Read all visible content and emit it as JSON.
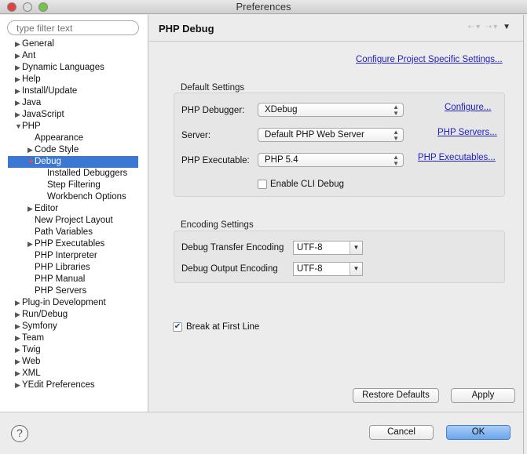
{
  "window": {
    "title": "Preferences"
  },
  "sidebar": {
    "filter_placeholder": "type filter text",
    "items": [
      {
        "label": "General",
        "level": 0,
        "exp": "c"
      },
      {
        "label": "Ant",
        "level": 0,
        "exp": "c"
      },
      {
        "label": "Dynamic Languages",
        "level": 0,
        "exp": "c"
      },
      {
        "label": "Help",
        "level": 0,
        "exp": "c"
      },
      {
        "label": "Install/Update",
        "level": 0,
        "exp": "c"
      },
      {
        "label": "Java",
        "level": 0,
        "exp": "c"
      },
      {
        "label": "JavaScript",
        "level": 0,
        "exp": "c"
      },
      {
        "label": "PHP",
        "level": 0,
        "exp": "e"
      },
      {
        "label": "Appearance",
        "level": 1,
        "exp": ""
      },
      {
        "label": "Code Style",
        "level": 1,
        "exp": "c"
      },
      {
        "label": "Debug",
        "level": 1,
        "exp": "e",
        "selected": true
      },
      {
        "label": "Installed Debuggers",
        "level": 2,
        "exp": ""
      },
      {
        "label": "Step Filtering",
        "level": 2,
        "exp": ""
      },
      {
        "label": "Workbench Options",
        "level": 2,
        "exp": ""
      },
      {
        "label": "Editor",
        "level": 1,
        "exp": "c"
      },
      {
        "label": "New Project Layout",
        "level": 1,
        "exp": ""
      },
      {
        "label": "Path Variables",
        "level": 1,
        "exp": ""
      },
      {
        "label": "PHP Executables",
        "level": 1,
        "exp": "c"
      },
      {
        "label": "PHP Interpreter",
        "level": 1,
        "exp": ""
      },
      {
        "label": "PHP Libraries",
        "level": 1,
        "exp": ""
      },
      {
        "label": "PHP Manual",
        "level": 1,
        "exp": ""
      },
      {
        "label": "PHP Servers",
        "level": 1,
        "exp": ""
      },
      {
        "label": "Plug-in Development",
        "level": 0,
        "exp": "c"
      },
      {
        "label": "Run/Debug",
        "level": 0,
        "exp": "c"
      },
      {
        "label": "Symfony",
        "level": 0,
        "exp": "c"
      },
      {
        "label": "Team",
        "level": 0,
        "exp": "c"
      },
      {
        "label": "Twig",
        "level": 0,
        "exp": "c"
      },
      {
        "label": "Web",
        "level": 0,
        "exp": "c"
      },
      {
        "label": "XML",
        "level": 0,
        "exp": "c"
      },
      {
        "label": "YEdit Preferences",
        "level": 0,
        "exp": "c"
      }
    ]
  },
  "page": {
    "title": "PHP Debug",
    "project_link": "Configure Project Specific Settings...",
    "default_settings": {
      "title": "Default Settings",
      "debugger_label": "PHP Debugger:",
      "debugger_value": "XDebug",
      "debugger_link": "Configure...",
      "server_label": "Server:",
      "server_value": "Default PHP Web Server",
      "server_link": "PHP Servers...",
      "exec_label": "PHP Executable:",
      "exec_value": "PHP 5.4",
      "exec_link": "PHP Executables...",
      "cli_label": "Enable CLI Debug",
      "cli_checked": false
    },
    "encoding_settings": {
      "title": "Encoding Settings",
      "transfer_label": "Debug Transfer Encoding",
      "transfer_value": "UTF-8",
      "output_label": "Debug Output Encoding",
      "output_value": "UTF-8"
    },
    "break_label": "Break at First Line",
    "break_checked": true,
    "restore_label": "Restore Defaults",
    "apply_label": "Apply"
  },
  "footer": {
    "help": "?",
    "cancel_label": "Cancel",
    "ok_label": "OK"
  }
}
